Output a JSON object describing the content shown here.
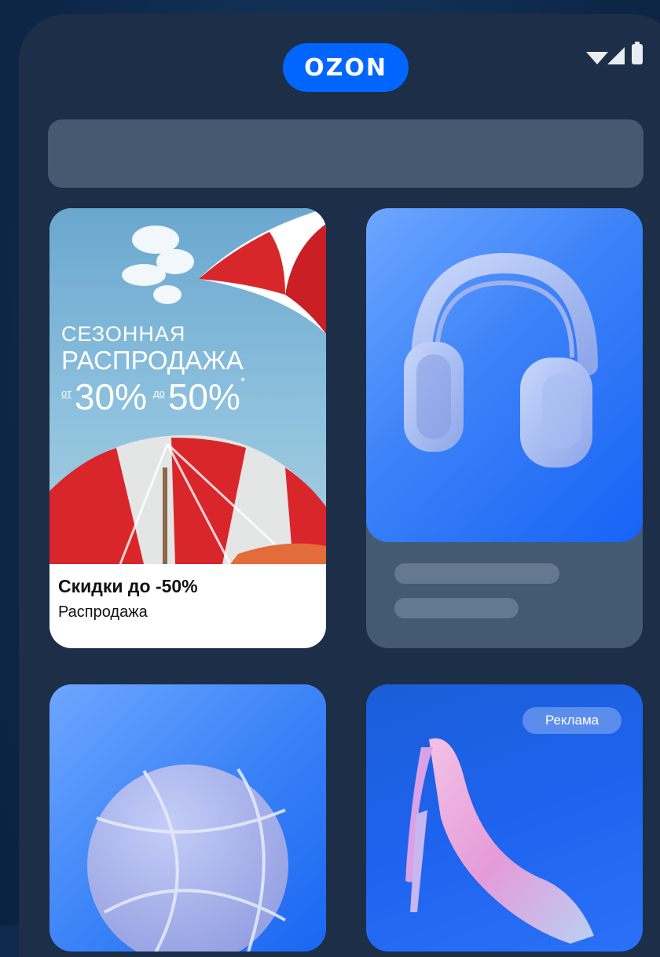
{
  "header": {
    "logo_text": "OZON",
    "status_icons": [
      "wifi-icon",
      "signal-icon",
      "battery-icon"
    ]
  },
  "search": {
    "placeholder": ""
  },
  "promo_card": {
    "banner_line1": "СЕЗОННАЯ",
    "banner_line2": "РАСПРОДАЖА",
    "banner_from_label": "от",
    "banner_from_value": "30%",
    "banner_to_label": "до",
    "banner_to_value": "50%",
    "banner_footnote": "*",
    "title": "Скидки до -50%",
    "subtitle": "Распродажа"
  },
  "products": [
    {
      "image": "headphones"
    },
    {
      "image": "basketball"
    },
    {
      "image": "high-heel-shoe",
      "badge": "Реклама"
    }
  ],
  "colors": {
    "brand_blue": "#0066ff",
    "background": "#1c2e48",
    "skeleton": "#647990"
  }
}
